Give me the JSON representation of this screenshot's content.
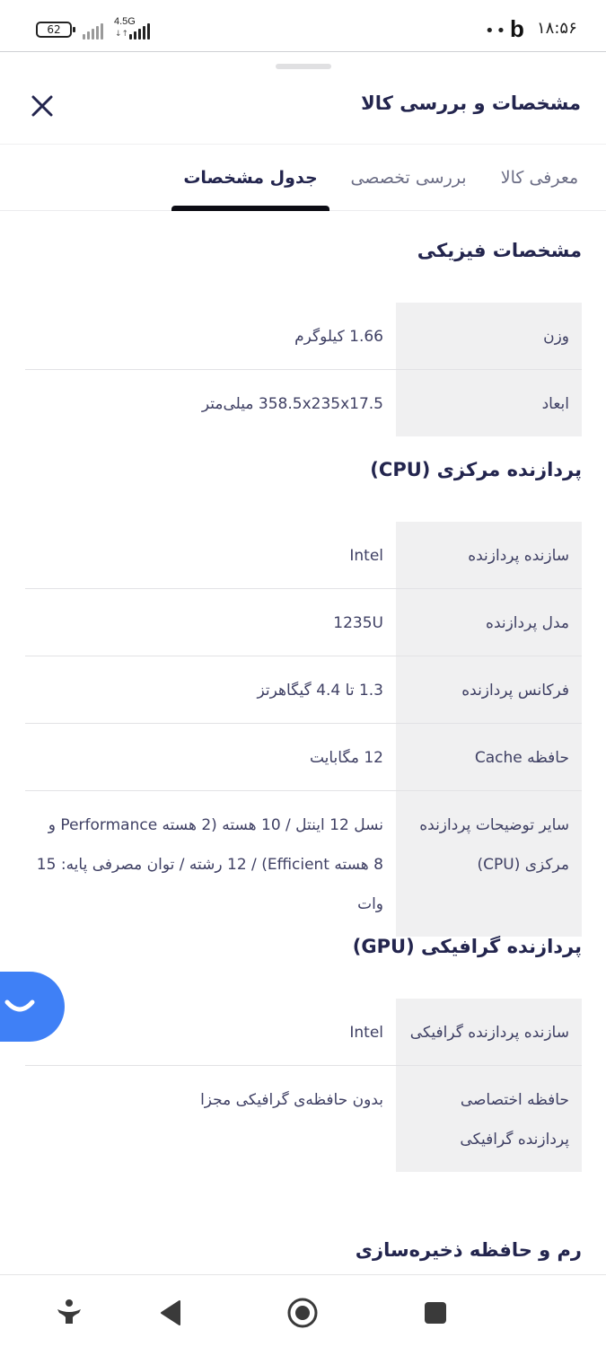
{
  "status_bar": {
    "battery": "62",
    "network": "4.5G",
    "network_arrows": "↓↑",
    "notification_dots": "••",
    "app_letter": "b",
    "time": "۱۸:۵۶"
  },
  "sheet": {
    "title": "مشخصات و بررسی کالا",
    "tabs": [
      {
        "label": "معرفی کالا",
        "active": false
      },
      {
        "label": "بررسی تخصصی",
        "active": false
      },
      {
        "label": "جدول مشخصات",
        "active": true
      }
    ]
  },
  "sections": [
    {
      "title": "مشخصات فیزیکی",
      "rows": [
        {
          "key": "وزن",
          "value": "1.66 کیلوگرم"
        },
        {
          "key": "ابعاد",
          "value": "358.5x235x17.5 میلی‌متر"
        }
      ]
    },
    {
      "title": "پردازنده مرکزی (CPU)",
      "rows": [
        {
          "key": "سازنده پردازنده",
          "value": "Intel"
        },
        {
          "key": "مدل پردازنده",
          "value": "1235U"
        },
        {
          "key": "فرکانس پردازنده",
          "value": "1.3 تا 4.4 گیگاهرتز"
        },
        {
          "key": "حافظه Cache",
          "value": "12 مگابایت"
        },
        {
          "key": "سایر توضیحات پردازنده مرکزی (CPU)",
          "value": "نسل 12 اینتل / 10 هسته (2 هسته Performance و 8 هسته Efficient) / 12 رشته / توان مصرفی پایه: 15 وات"
        }
      ]
    },
    {
      "title": "پردازنده گرافیکی (GPU)",
      "rows": [
        {
          "key": "سازنده پردازنده گرافیکی",
          "value": "Intel"
        },
        {
          "key": "حافظه اختصاصی پردازنده گرافیکی",
          "value": "بدون حافظه‌ی گرافیکی مجزا"
        }
      ]
    },
    {
      "title": "رم و حافظه ذخیره‌سازی",
      "rows": []
    }
  ],
  "icons": {
    "close": "close-icon",
    "chat": "chat-smile-icon",
    "nav": [
      "accessibility-icon",
      "back-icon",
      "home-icon",
      "recents-icon"
    ]
  },
  "colors": {
    "title": "#23254e",
    "text": "#3f4064",
    "key_bg": "#f0f0f1",
    "tab_indicator": "#0c0c14",
    "chat_fab": "#3f80f6"
  }
}
